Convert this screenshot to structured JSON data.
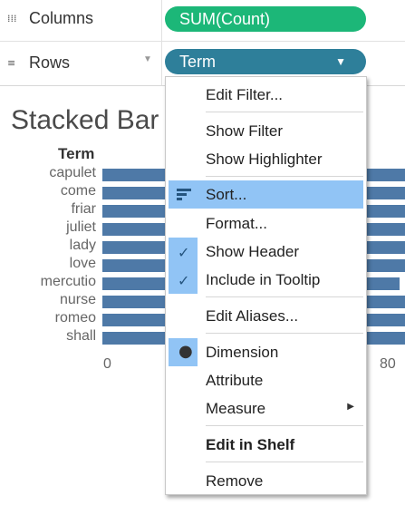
{
  "shelves": {
    "columns": {
      "icon": "columns-icon",
      "label": "Columns",
      "pill": "SUM(Count)",
      "pill_color": "#1cb778"
    },
    "rows": {
      "icon": "rows-icon",
      "label": "Rows",
      "pill": "Term",
      "pill_color": "#2e7f9a"
    }
  },
  "chart": {
    "title": "Stacked Bar",
    "row_header": "Term",
    "bar_color": "#4e79a7",
    "terms": [
      "capulet",
      "come",
      "friar",
      "juliet",
      "lady",
      "love",
      "mercutio",
      "nurse",
      "romeo",
      "shall"
    ],
    "axis_ticks": [
      "0",
      "80"
    ]
  },
  "menu": {
    "items": [
      {
        "label": "Edit Filter...",
        "name": "menu-edit-filter"
      },
      {
        "label": "Show Filter",
        "name": "menu-show-filter"
      },
      {
        "label": "Show Highlighter",
        "name": "menu-show-highlighter"
      },
      {
        "label": "Sort...",
        "name": "menu-sort",
        "icon": "sort-icon",
        "highlighted": true
      },
      {
        "label": "Format...",
        "name": "menu-format"
      },
      {
        "label": "Show Header",
        "name": "menu-show-header",
        "checked": true
      },
      {
        "label": "Include in Tooltip",
        "name": "menu-include-in-tooltip",
        "checked": true
      },
      {
        "label": "Edit Aliases...",
        "name": "menu-edit-aliases"
      },
      {
        "label": "Dimension",
        "name": "menu-dimension",
        "selected": true
      },
      {
        "label": "Attribute",
        "name": "menu-attribute"
      },
      {
        "label": "Measure",
        "name": "menu-measure",
        "submenu": true
      },
      {
        "label": "Edit in Shelf",
        "name": "menu-edit-in-shelf",
        "bold": true
      },
      {
        "label": "Remove",
        "name": "menu-remove"
      }
    ],
    "highlight_color": "#91c4f5"
  }
}
